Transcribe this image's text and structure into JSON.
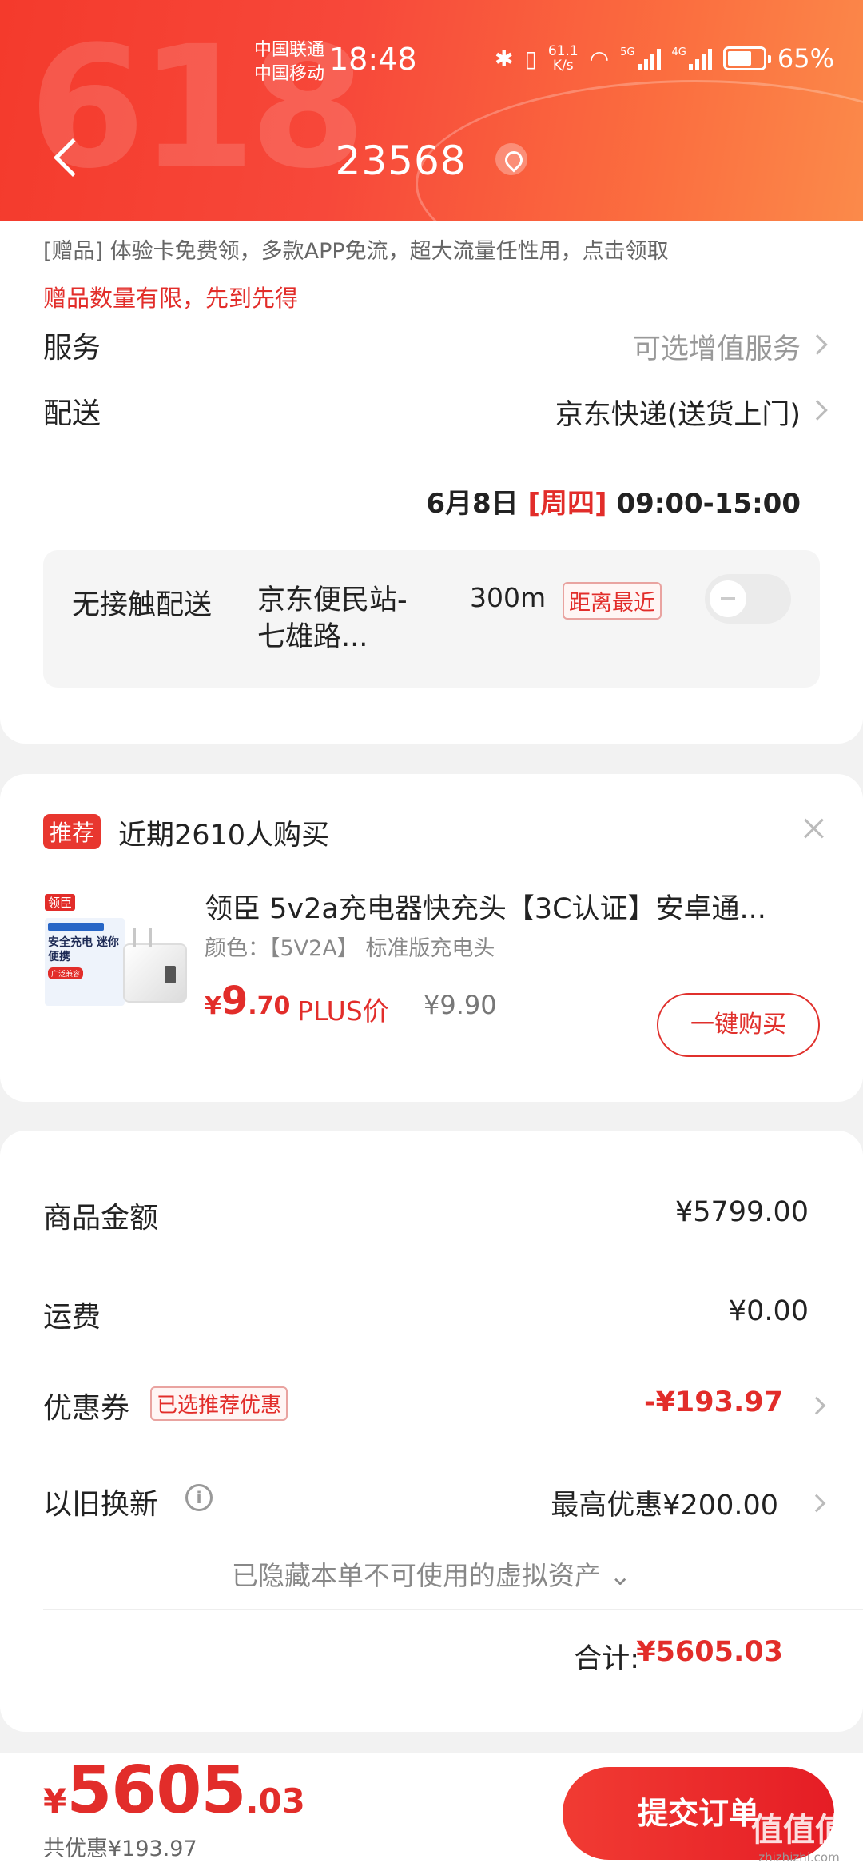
{
  "status_bar": {
    "carrier_1": "中国联通",
    "carrier_2": "中国移动",
    "time": "18:48",
    "net_speed_value": "61.1",
    "net_speed_unit": "K/s",
    "sig1_label": "5G",
    "sig2_label": "4G",
    "battery": "65%"
  },
  "header": {
    "bg_text": "618",
    "title": "23568"
  },
  "gift": {
    "line": "[赠品] 体验卡免费领，多款APP免流，超大流量任性用，点击领取",
    "warning": "赠品数量有限，先到先得"
  },
  "service": {
    "label": "服务",
    "value": "可选增值服务"
  },
  "delivery": {
    "label": "配送",
    "method": "京东快递(送货上门)",
    "date": "6月8日",
    "weekday": "[周四]",
    "time_window": "09:00-15:00"
  },
  "contactless": {
    "label": "无接触配送",
    "station": "京东便民站-七雄路...",
    "distance": "300m",
    "tag": "距离最近"
  },
  "recommend": {
    "badge": "推荐",
    "count_text": "近期2610人购买",
    "product": {
      "brand_tag": "领臣",
      "package_text": "安全充电 迷你便携",
      "package_pill": "广泛兼容",
      "title": "领臣 5v2a充电器快充头【3C认证】安卓通...",
      "spec": "颜色：【5V2A】 标准版充电头",
      "price_currency": "¥",
      "price_int": "9",
      "price_dec": ".70",
      "plus_label": "PLUS价",
      "plus_price": "¥9.90",
      "buy_label": "一键购买"
    }
  },
  "totals": {
    "goods_label": "商品金额",
    "goods_value": "¥5799.00",
    "shipping_label": "运费",
    "shipping_value": "¥0.00",
    "coupon_label": "优惠券",
    "coupon_tag": "已选推荐优惠",
    "coupon_value": "-¥193.97",
    "tradein_label": "以旧换新",
    "tradein_info": "i",
    "tradein_value": "最高优惠¥200.00",
    "hidden_note": "已隐藏本单不可使用的虚拟资产 ⌄",
    "sum_label": "合计:",
    "sum_value": "¥5605.03"
  },
  "bottom": {
    "price_currency": "¥",
    "price_int": "5605",
    "price_dec": ".03",
    "saved": "共优惠¥193.97",
    "submit": "提交订单",
    "watermark_main": "值值值",
    "watermark_sub": "zhizhizhi.com"
  },
  "colors": {
    "accent": "#e22d2a",
    "header_start": "#f43a2c",
    "header_end": "#fb8a4a"
  }
}
